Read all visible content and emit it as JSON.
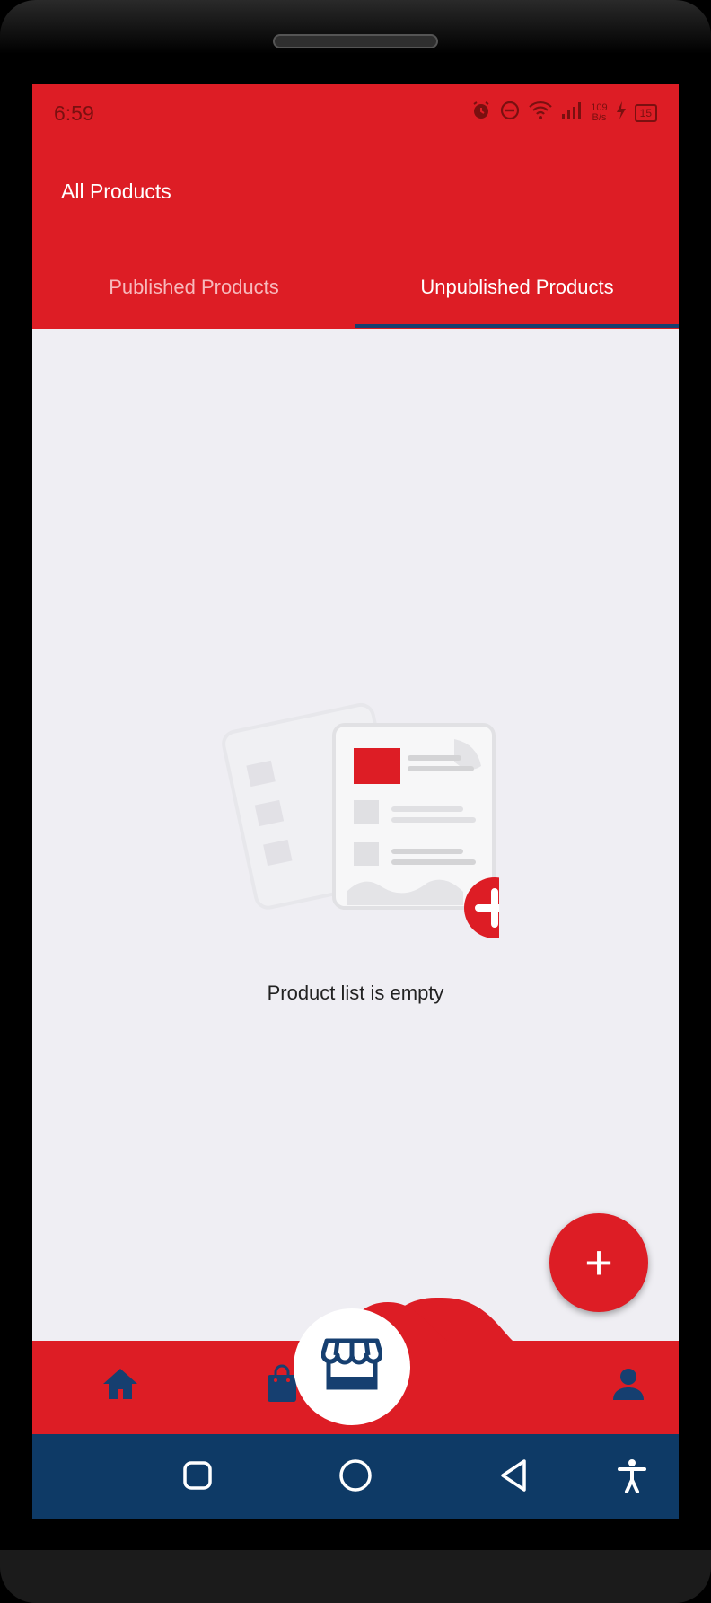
{
  "status_bar": {
    "time": "6:59",
    "net_speed_value": "109",
    "net_speed_unit": "B/s",
    "battery": "15"
  },
  "header": {
    "title": "All Products"
  },
  "tabs": [
    {
      "label": "Published Products",
      "selected": false
    },
    {
      "label": "Unpublished Products",
      "selected": true
    }
  ],
  "empty_state": {
    "message": "Product list is empty"
  },
  "fab": {
    "label": "+"
  },
  "bottom_nav": {
    "items": [
      "home-icon",
      "shopping-bag-icon",
      "storefront-icon",
      "person-icon"
    ],
    "active": "storefront-icon"
  },
  "system_nav": {
    "items": [
      "recents-icon",
      "home-circle-icon",
      "back-icon",
      "accessibility-icon"
    ]
  },
  "colors": {
    "primary": "#dd1d25",
    "navy": "#163f70",
    "system_nav": "#0e3a66",
    "background": "#efeef3"
  }
}
